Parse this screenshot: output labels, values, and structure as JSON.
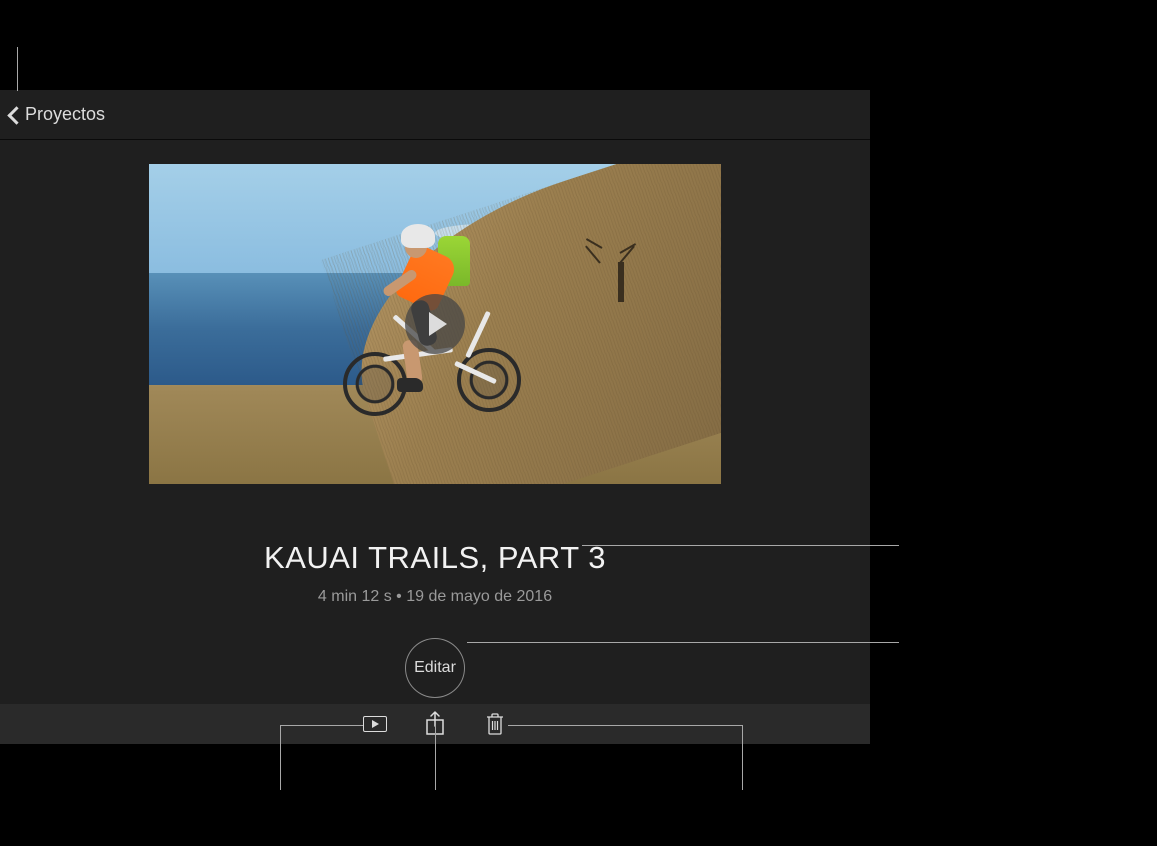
{
  "nav": {
    "back_label": "Proyectos"
  },
  "project": {
    "title": "KAUAI TRAILS, PART 3",
    "meta": "4 min 12 s • 19 de mayo de 2016"
  },
  "actions": {
    "edit_label": "Editar"
  },
  "icons": {
    "play": "play-rect-icon",
    "share": "share-icon",
    "delete": "trash-icon"
  }
}
